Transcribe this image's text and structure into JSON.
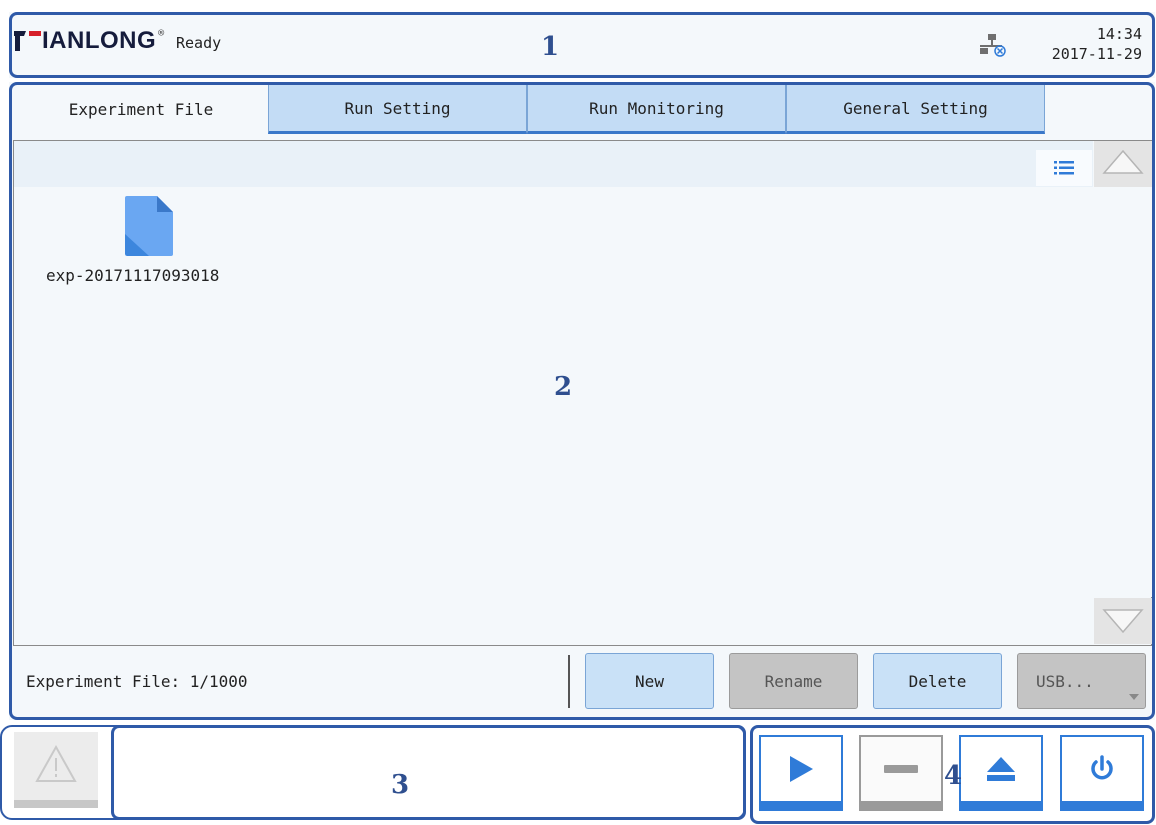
{
  "header": {
    "brand": "IANLONG",
    "status": "Ready",
    "time": "14:34",
    "date": "2017-11-29"
  },
  "annotations": {
    "r1": "1",
    "r2": "2",
    "r3": "3",
    "r4": "4"
  },
  "tabs": [
    {
      "label": "Experiment File",
      "active": true
    },
    {
      "label": "Run Setting",
      "active": false
    },
    {
      "label": "Run Monitoring",
      "active": false
    },
    {
      "label": "General Setting",
      "active": false
    }
  ],
  "files": [
    {
      "name": "exp-20171117093018"
    }
  ],
  "footer": {
    "count_text": "Experiment File: 1/1000",
    "buttons": {
      "new": "New",
      "rename": "Rename",
      "delete": "Delete",
      "usb": "USB..."
    }
  },
  "colors": {
    "accent": "#2f7bd8",
    "outline": "#2f5aa8",
    "tab_bg": "#c3dcf5",
    "panel_bg": "#f4f8fb",
    "logo": "#d6202a"
  },
  "icons": [
    "network-icon",
    "file-icon",
    "list-view-icon",
    "scroll-up-icon",
    "scroll-down-icon",
    "warning-icon",
    "play-icon",
    "stop-icon",
    "eject-icon",
    "power-icon"
  ]
}
